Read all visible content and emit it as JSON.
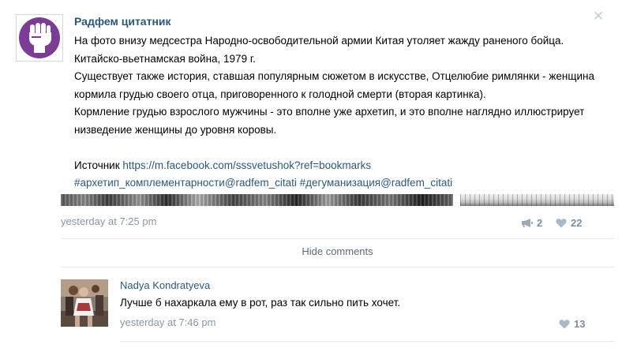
{
  "post": {
    "group_name": "Радфем цитатник",
    "text_lines": [
      "На фото внизу медсестра Народно-освободительной армии Китая утоляет жажду раненого бойца.",
      "Китайско-вьетнамская война, 1979 г.",
      "Существует также история, ставшая популярным сюжетом в искусстве, Отцелюбие римлянки - женщина",
      "кормила грудью своего отца, приговоренного к голодной смерти (вторая картинка).",
      "Кормление грудью взрослого мужчины - это вполне уже архетип, и это вполне наглядно иллюстрирует",
      "низведение женщины до уровня коровы."
    ],
    "source_label": "Источник",
    "source_link": "https://m.facebook.com/sssvetushok?ref=bookmarks",
    "hashtag_1": "#архетип_комплементарности@radfem_citati",
    "hashtag_2": "#дегуманизация@radfem_citati",
    "date": "yesterday at 7:25 pm",
    "share_count": "2",
    "like_count": "22",
    "close_icon": "close-icon",
    "avatar_icon": "raised-fist-icon",
    "accent_color": "#2b587a",
    "avatar_color": "#7b3c96"
  },
  "comments": {
    "hide_label": "Hide comments",
    "items": [
      {
        "author": "Nadya Kondratyeva",
        "text": "Лучше б нахаркала ему в рот, раз так сильно пить хочет.",
        "date": "yesterday at 7:46 pm",
        "like_count": "13"
      }
    ]
  }
}
